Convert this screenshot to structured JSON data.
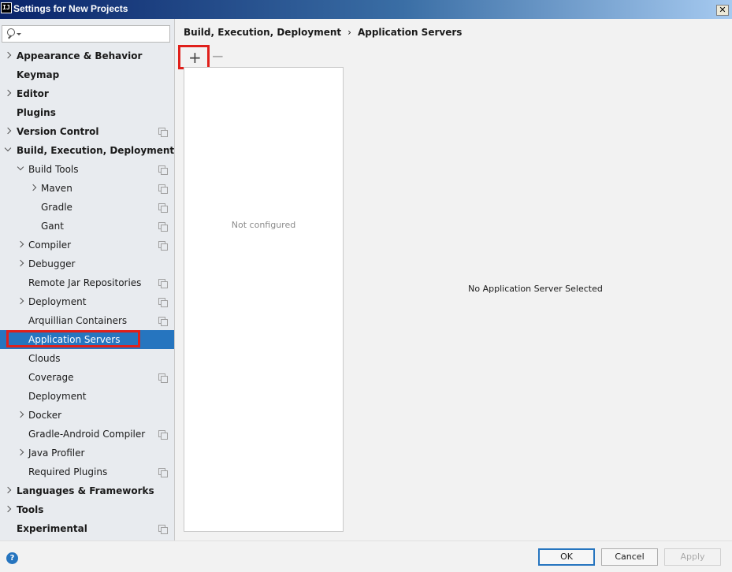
{
  "window": {
    "title": "Settings for New Projects",
    "app_icon_text": "IJ",
    "close_label": "✕"
  },
  "search": {
    "value": "",
    "placeholder": ""
  },
  "sidebar": {
    "items": [
      {
        "label": "Appearance & Behavior",
        "level": 0,
        "chevron": "right",
        "bold": true,
        "copy": false
      },
      {
        "label": "Keymap",
        "level": 0,
        "chevron": "",
        "bold": true,
        "copy": false
      },
      {
        "label": "Editor",
        "level": 0,
        "chevron": "right",
        "bold": true,
        "copy": false
      },
      {
        "label": "Plugins",
        "level": 0,
        "chevron": "",
        "bold": true,
        "copy": false
      },
      {
        "label": "Version Control",
        "level": 0,
        "chevron": "right",
        "bold": true,
        "copy": true
      },
      {
        "label": "Build, Execution, Deployment",
        "level": 0,
        "chevron": "down",
        "bold": true,
        "copy": false
      },
      {
        "label": "Build Tools",
        "level": 1,
        "chevron": "down",
        "bold": false,
        "copy": true
      },
      {
        "label": "Maven",
        "level": 2,
        "chevron": "right",
        "bold": false,
        "copy": true
      },
      {
        "label": "Gradle",
        "level": 2,
        "chevron": "",
        "bold": false,
        "copy": true
      },
      {
        "label": "Gant",
        "level": 2,
        "chevron": "",
        "bold": false,
        "copy": true
      },
      {
        "label": "Compiler",
        "level": 1,
        "chevron": "right",
        "bold": false,
        "copy": true
      },
      {
        "label": "Debugger",
        "level": 1,
        "chevron": "right",
        "bold": false,
        "copy": false
      },
      {
        "label": "Remote Jar Repositories",
        "level": 1,
        "chevron": "",
        "bold": false,
        "copy": true
      },
      {
        "label": "Deployment",
        "level": 1,
        "chevron": "right",
        "bold": false,
        "copy": true
      },
      {
        "label": "Arquillian Containers",
        "level": 1,
        "chevron": "",
        "bold": false,
        "copy": true
      },
      {
        "label": "Application Servers",
        "level": 1,
        "chevron": "",
        "bold": false,
        "copy": false,
        "selected": true
      },
      {
        "label": "Clouds",
        "level": 1,
        "chevron": "",
        "bold": false,
        "copy": false
      },
      {
        "label": "Coverage",
        "level": 1,
        "chevron": "",
        "bold": false,
        "copy": true
      },
      {
        "label": "Deployment",
        "level": 1,
        "chevron": "",
        "bold": false,
        "copy": false
      },
      {
        "label": "Docker",
        "level": 1,
        "chevron": "right",
        "bold": false,
        "copy": false
      },
      {
        "label": "Gradle-Android Compiler",
        "level": 1,
        "chevron": "",
        "bold": false,
        "copy": true
      },
      {
        "label": "Java Profiler",
        "level": 1,
        "chevron": "right",
        "bold": false,
        "copy": false
      },
      {
        "label": "Required Plugins",
        "level": 1,
        "chevron": "",
        "bold": false,
        "copy": true
      },
      {
        "label": "Languages & Frameworks",
        "level": 0,
        "chevron": "right",
        "bold": true,
        "copy": false
      },
      {
        "label": "Tools",
        "level": 0,
        "chevron": "right",
        "bold": true,
        "copy": false
      },
      {
        "label": "Experimental",
        "level": 0,
        "chevron": "",
        "bold": true,
        "copy": true
      }
    ]
  },
  "breadcrumb": {
    "parent": "Build, Execution, Deployment",
    "separator": "›",
    "current": "Application Servers"
  },
  "toolbar": {
    "add_label": "+",
    "remove_label": "−"
  },
  "server_list": {
    "empty_text": "Not configured"
  },
  "detail": {
    "empty_text": "No Application Server Selected"
  },
  "footer": {
    "help_label": "?",
    "ok_label": "OK",
    "cancel_label": "Cancel",
    "apply_label": "Apply"
  },
  "colors": {
    "selection": "#2675bf",
    "highlight_box": "#e0201b"
  }
}
